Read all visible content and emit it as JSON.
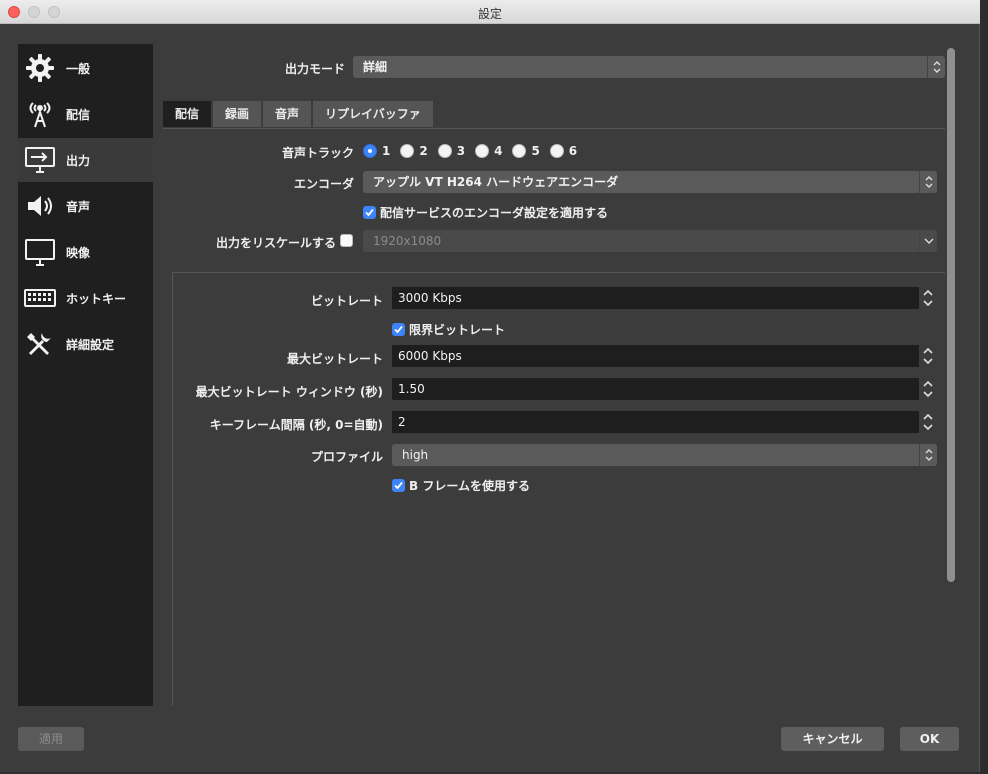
{
  "window": {
    "title": "設定"
  },
  "sidebar": {
    "items": [
      {
        "label": "一般",
        "icon": "gear-icon"
      },
      {
        "label": "配信",
        "icon": "broadcast-antenna-icon"
      },
      {
        "label": "出力",
        "icon": "output-monitor-icon",
        "active": true
      },
      {
        "label": "音声",
        "icon": "speaker-icon"
      },
      {
        "label": "映像",
        "icon": "monitor-icon"
      },
      {
        "label": "ホットキー",
        "icon": "keyboard-icon"
      },
      {
        "label": "詳細設定",
        "icon": "tools-icon"
      }
    ]
  },
  "output_mode": {
    "label": "出力モード",
    "value": "詳細"
  },
  "tabs": [
    {
      "label": "配信",
      "active": true
    },
    {
      "label": "録画"
    },
    {
      "label": "音声"
    },
    {
      "label": "リプレイバッファ"
    }
  ],
  "audio_track": {
    "label": "音声トラック",
    "options": [
      "1",
      "2",
      "3",
      "4",
      "5",
      "6"
    ],
    "selected": "1"
  },
  "encoder": {
    "label": "エンコーダ",
    "value": "アップル VT H264 ハードウェアエンコーダ"
  },
  "apply_service": {
    "label": "配信サービスのエンコーダ設定を適用する",
    "checked": true
  },
  "rescale": {
    "label": "出力をリスケールする",
    "checked": false,
    "value": "1920x1080"
  },
  "bitrate": {
    "label": "ビットレート",
    "value": "3000 Kbps"
  },
  "limit_bitrate": {
    "label": "限界ビットレート",
    "checked": true
  },
  "max_bitrate": {
    "label": "最大ビットレート",
    "value": "6000 Kbps"
  },
  "max_bitrate_window": {
    "label": "最大ビットレート ウィンドウ (秒)",
    "value": "1.50"
  },
  "keyframe": {
    "label": "キーフレーム間隔 (秒, 0=自動)",
    "value": "2"
  },
  "profile": {
    "label": "プロファイル",
    "value": "high"
  },
  "bframes": {
    "label": "B フレームを使用する",
    "checked": true
  },
  "buttons": {
    "apply": "適用",
    "cancel": "キャンセル",
    "ok": "OK"
  },
  "colors": {
    "accent": "#3c84f7",
    "sidebar_bg": "#1f1f1f",
    "panel_bg": "#3c3c3c"
  }
}
